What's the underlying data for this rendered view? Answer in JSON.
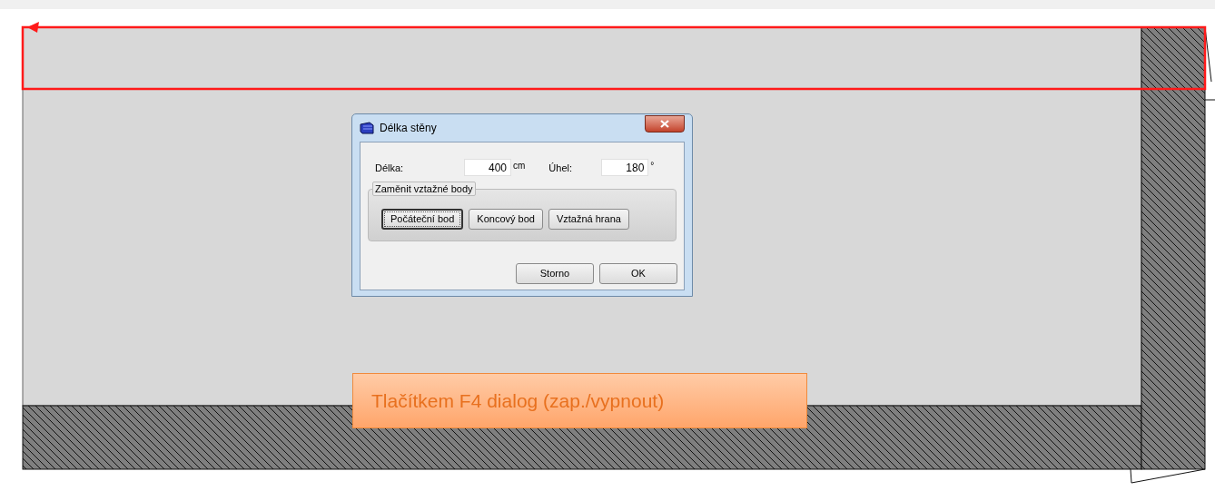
{
  "dialog": {
    "title": "Délka stěny",
    "fields": [
      {
        "label": "Délka:",
        "value": "400",
        "unit": "cm"
      },
      {
        "label": "Úhel:",
        "value": "180",
        "unit": "°"
      }
    ],
    "group": {
      "label": "Zaměnit vztažné body",
      "buttons": [
        {
          "label": "Počáteční bod",
          "focused": true
        },
        {
          "label": "Koncový bod",
          "focused": false
        },
        {
          "label": "Vztažná hrana",
          "focused": false
        }
      ]
    },
    "buttons": [
      {
        "label": "Storno",
        "focused": false
      },
      {
        "label": "OK",
        "focused": false
      }
    ]
  },
  "callout": {
    "text": "Tlačítkem F4 dialog (zap./vypnout)"
  }
}
